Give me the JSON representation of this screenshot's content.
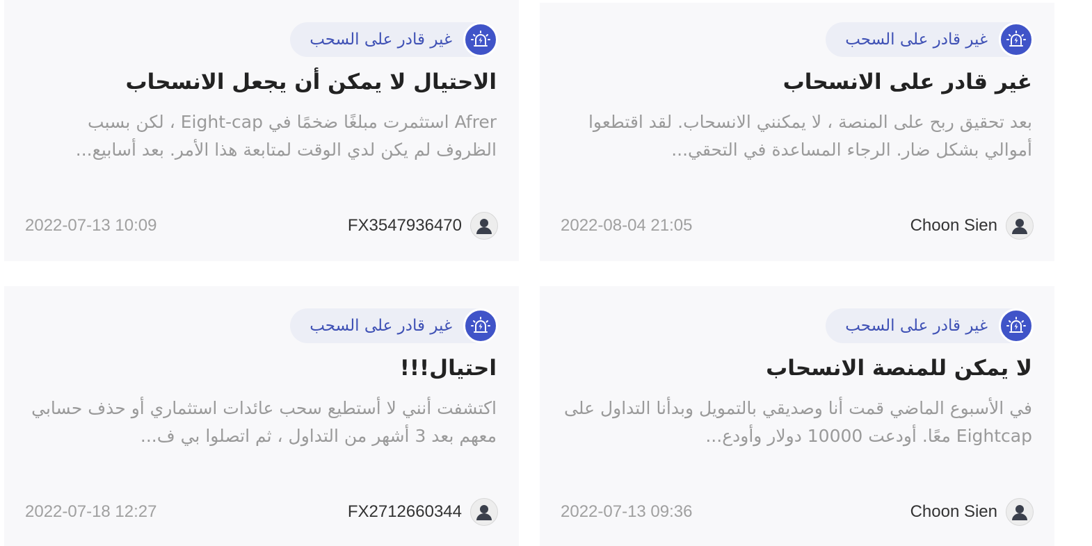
{
  "colors": {
    "card_bg": "#f8f8fa",
    "accent": "#3f51b5",
    "tag_bg": "#eceef6",
    "title": "#222222",
    "excerpt": "#9a9a9a",
    "date": "#a0a0a0"
  },
  "cards": [
    {
      "tag_icon": "siren-alert-icon",
      "tag_label": "غير قادر على السحب",
      "title": "الاحتيال لا يمكن أن يجعل الانسحاب",
      "excerpt": "Afrer استثمرت مبلغًا ضخمًا في Eight-cap ، لكن بسبب الظروف لم يكن لدي الوقت لمتابعة هذا الأمر. بعد أسابيع...",
      "username": "FX3547936470",
      "date": "2022-07-13 10:09"
    },
    {
      "tag_icon": "siren-alert-icon",
      "tag_label": "غير قادر على السحب",
      "title": "غير قادر على الانسحاب",
      "excerpt": "بعد تحقيق ربح على المنصة ، لا يمكنني الانسحاب. لقد اقتطعوا أموالي بشكل ضار. الرجاء المساعدة في التحقي...",
      "username": "Choon Sien",
      "date": "2022-08-04 21:05"
    },
    {
      "tag_icon": "siren-alert-icon",
      "tag_label": "غير قادر على السحب",
      "title": "احتيال!!!",
      "excerpt": "اكتشفت أنني لا أستطيع سحب عائدات استثماري أو حذف حسابي معهم بعد 3 أشهر من التداول ، ثم اتصلوا بي ف...",
      "username": "FX2712660344",
      "date": "2022-07-18 12:27"
    },
    {
      "tag_icon": "siren-alert-icon",
      "tag_label": "غير قادر على السحب",
      "title": "لا يمكن للمنصة الانسحاب",
      "excerpt": "في الأسبوع الماضي قمت أنا وصديقي بالتمويل وبدأنا التداول على Eightcap معًا. أودعت 10000 دولار وأودع...",
      "username": "Choon Sien",
      "date": "2022-07-13 09:36"
    }
  ]
}
